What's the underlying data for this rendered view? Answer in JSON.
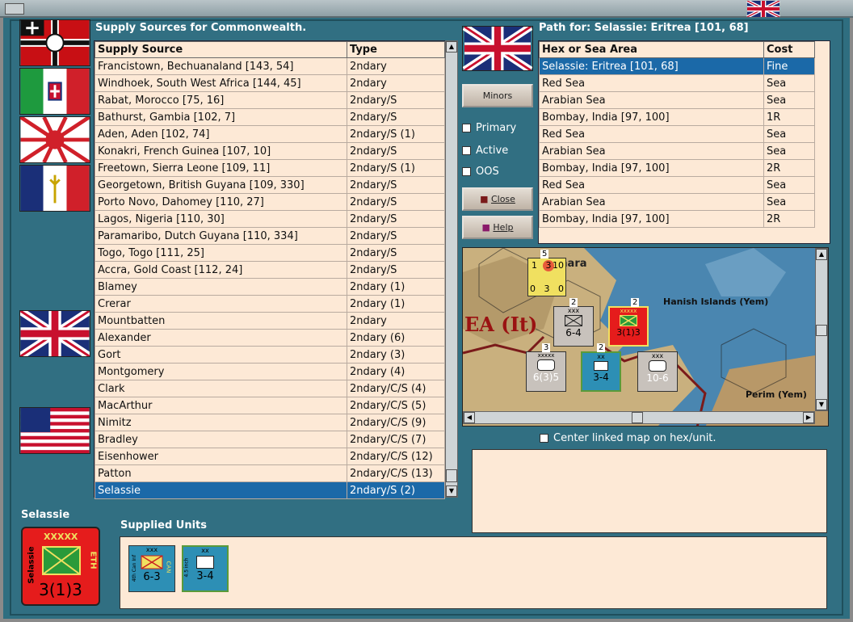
{
  "window": {
    "title_flag": "uk-flag-icon"
  },
  "supply_panel": {
    "title": "Supply Sources for Commonwealth.",
    "columns": [
      "Supply Source",
      "Type"
    ],
    "rows": [
      [
        "Francistown, Bechuanaland [143, 54]",
        "2ndary"
      ],
      [
        "Windhoek, South West Africa [144, 45]",
        "2ndary"
      ],
      [
        "Rabat, Morocco [75, 16]",
        "2ndary/S"
      ],
      [
        "Bathurst, Gambia [102, 7]",
        "2ndary/S"
      ],
      [
        "Aden, Aden [102, 74]",
        "2ndary/S (1)"
      ],
      [
        "Konakri, French Guinea [107, 10]",
        "2ndary/S"
      ],
      [
        "Freetown, Sierra Leone [109, 11]",
        "2ndary/S (1)"
      ],
      [
        "Georgetown, British Guyana [109, 330]",
        "2ndary/S"
      ],
      [
        "Porto Novo, Dahomey [110, 27]",
        "2ndary/S"
      ],
      [
        "Lagos, Nigeria [110, 30]",
        "2ndary/S"
      ],
      [
        "Paramaribo, Dutch Guyana [110, 334]",
        "2ndary/S"
      ],
      [
        "Togo, Togo [111, 25]",
        "2ndary/S"
      ],
      [
        "Accra, Gold Coast [112, 24]",
        "2ndary/S"
      ],
      [
        "Blamey",
        "2ndary (1)"
      ],
      [
        "Crerar",
        "2ndary (1)"
      ],
      [
        "Mountbatten",
        "2ndary"
      ],
      [
        "Alexander",
        "2ndary (6)"
      ],
      [
        "Gort",
        "2ndary (3)"
      ],
      [
        "Montgomery",
        "2ndary (4)"
      ],
      [
        "Clark",
        "2ndary/C/S (4)"
      ],
      [
        "MacArthur",
        "2ndary/C/S (5)"
      ],
      [
        "Nimitz",
        "2ndary/C/S (9)"
      ],
      [
        "Bradley",
        "2ndary/C/S (7)"
      ],
      [
        "Eisenhower",
        "2ndary/C/S (12)"
      ],
      [
        "Patton",
        "2ndary/C/S (13)"
      ],
      [
        "Selassie",
        "2ndary/S (2)"
      ]
    ],
    "selected_index": 25
  },
  "path_panel": {
    "title": "Path for: Selassie: Eritrea [101, 68]",
    "columns": [
      "Hex or Sea Area",
      "Cost"
    ],
    "rows": [
      [
        "Selassie: Eritrea [101, 68]",
        "Fine"
      ],
      [
        "Red Sea",
        "Sea"
      ],
      [
        "Arabian Sea",
        "Sea"
      ],
      [
        "Bombay, India [97, 100]",
        "1R"
      ],
      [
        "Red Sea",
        "Sea"
      ],
      [
        "Arabian Sea",
        "Sea"
      ],
      [
        "Bombay, India [97, 100]",
        "2R"
      ],
      [
        "Red Sea",
        "Sea"
      ],
      [
        "Arabian Sea",
        "Sea"
      ],
      [
        "Bombay, India [97, 100]",
        "2R"
      ]
    ],
    "selected_index": 0
  },
  "controls": {
    "minors_label": "Minors",
    "primary_label": "Primary",
    "active_label": "Active",
    "oos_label": "OOS",
    "close_label": "Close",
    "help_label": "Help"
  },
  "map": {
    "labels": [
      "Hanish Islands (Yem)",
      "Perim (Yem)",
      "EA (It)",
      "mara"
    ],
    "counters": [
      {
        "top": "1",
        "mid": "3",
        "right": "10",
        "bottom": "0   3   0",
        "badge": "5"
      },
      {
        "type": "xxx",
        "value": "6-4",
        "badge": "2"
      },
      {
        "type": "xxxxx",
        "value": "3(1)3",
        "badge": "2"
      },
      {
        "type": "xxxxx",
        "value": "6(3)5",
        "badge": "3"
      },
      {
        "type": "xx",
        "value": "3-4",
        "badge": "2"
      },
      {
        "type": "xxx",
        "value": "10-6",
        "badge": ""
      }
    ]
  },
  "center_map_label": "Center linked map on hex/unit.",
  "selected_unit": {
    "name": "Selassie",
    "size": "XXXXX",
    "side_left": "Selassie",
    "side_right": "ETH",
    "strength": "3(1)3"
  },
  "supplied_units": {
    "title": "Supplied Units",
    "units": [
      {
        "size": "xxx",
        "left_text": "4th Can Inf",
        "right_text": "CAN",
        "strength": "6-3"
      },
      {
        "size": "xx",
        "left_text": "4.5 inch",
        "right_text": "",
        "strength": "3-4"
      }
    ]
  },
  "colors": {
    "background": "#316f82",
    "list_bg": "#fde9d6",
    "selection": "#1b69a8",
    "unit_red": "#e51c1c",
    "unit_blue": "#2d8fb5"
  }
}
